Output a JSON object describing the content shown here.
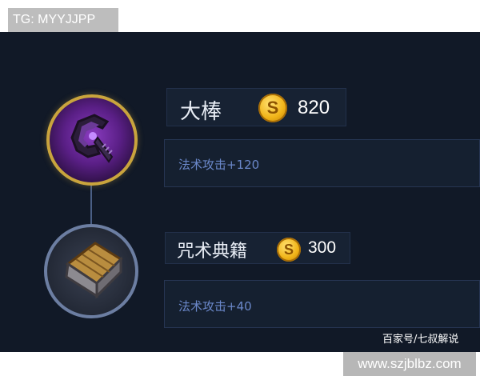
{
  "badge": {
    "text": "TG: MYYJJPP"
  },
  "items": [
    {
      "name": "大棒",
      "price": "820",
      "coin_symbol": "S",
      "stat": "法术攻击+120",
      "icon": "magic-staff-icon"
    },
    {
      "name": "咒术典籍",
      "price": "300",
      "coin_symbol": "S",
      "stat": "法术攻击+40",
      "icon": "spell-book-icon"
    }
  ],
  "credit": "百家号/七叔解说",
  "watermark": "www.szjblbz.com",
  "colors": {
    "panel_bg": "#111927",
    "gold_border": "#c9a43d",
    "stat_text": "#6a87c9",
    "coin_gold": "#f1b418"
  }
}
